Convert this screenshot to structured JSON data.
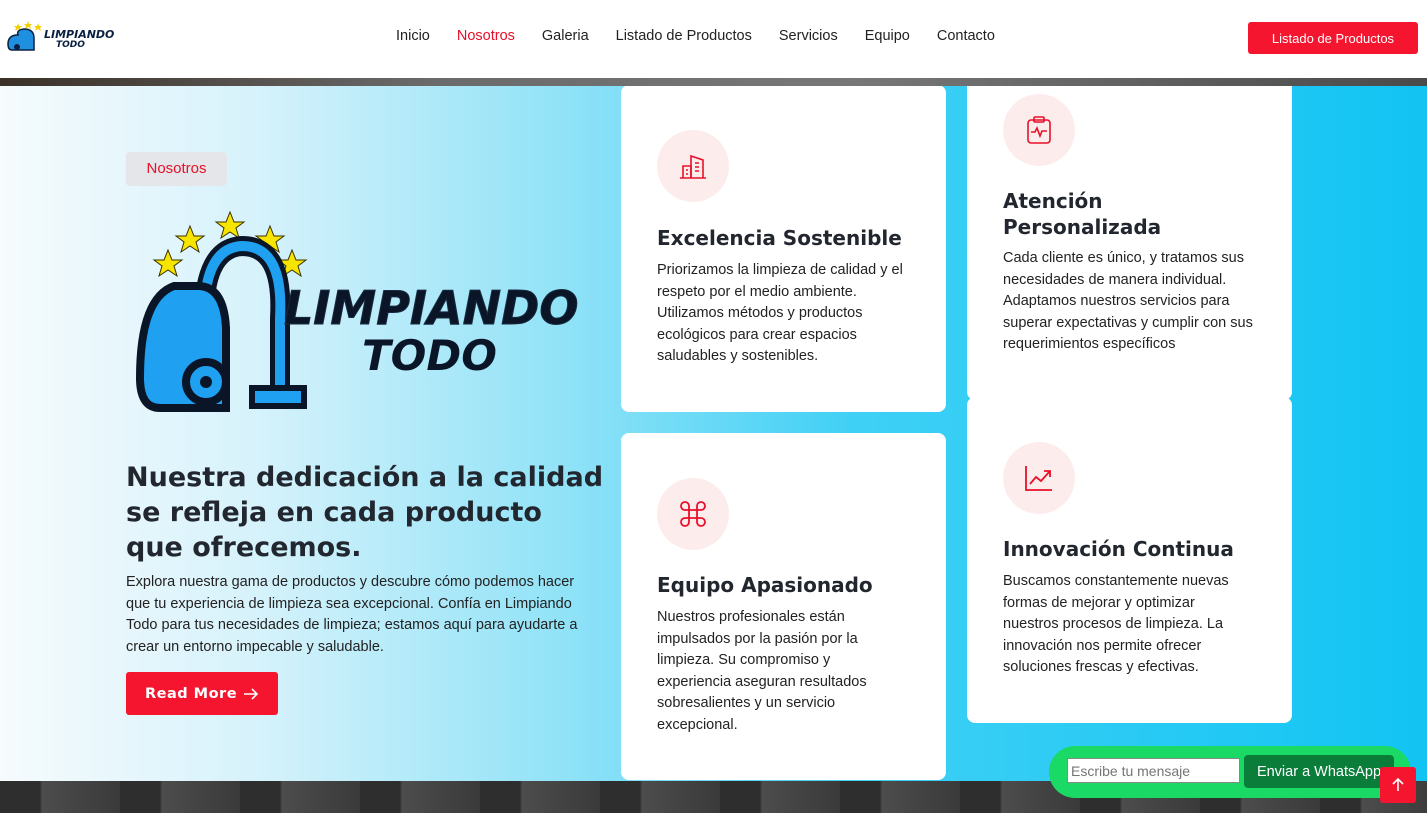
{
  "brand": {
    "name_line1": "LIMPIANDO",
    "name_line2": "TODO"
  },
  "nav": {
    "items": [
      "Inicio",
      "Nosotros",
      "Galeria",
      "Listado de Productos",
      "Servicios",
      "Equipo",
      "Contacto"
    ],
    "active": "Nosotros",
    "cta_label": "Listado de Productos"
  },
  "about": {
    "tag": "Nosotros",
    "heading": "Nuestra dedicación a la calidad se refleja en cada producto que ofrecemos.",
    "paragraph": "Explora nuestra gama de productos y descubre cómo podemos hacer que tu experiencia de limpieza sea excepcional. Confía en Limpiando Todo para tus necesidades de limpieza; estamos aquí para ayudarte a crear un entorno impecable y saludable.",
    "button_label": "Read More"
  },
  "features": [
    {
      "icon": "building-icon",
      "title": "Excelencia Sostenible",
      "text": "Priorizamos la limpieza de calidad y el respeto por el medio ambiente. Utilizamos métodos y productos ecológicos para crear espacios saludables y sostenibles."
    },
    {
      "icon": "clipboard-pulse-icon",
      "title": "Atención Personalizada",
      "text": "Cada cliente es único, y tratamos sus necesidades de manera individual. Adaptamos nuestros servicios para superar expectativas y cumplir con sus requerimientos específicos"
    },
    {
      "icon": "command-icon",
      "title": "Equipo Apasionado",
      "text": "Nuestros profesionales están impulsados por la pasión por la limpieza. Su compromiso y experiencia aseguran resultados sobresalientes y un servicio excepcional."
    },
    {
      "icon": "trend-chart-icon",
      "title": "Innovación Continua",
      "text": "Buscamos constantemente nuevas formas de mejorar y optimizar nuestros procesos de limpieza. La innovación nos permite ofrecer soluciones frescas y efectivas."
    }
  ],
  "whatsapp": {
    "placeholder": "Escribe tu mensaje",
    "button_label": "Enviar a WhatsApp"
  },
  "colors": {
    "accent": "#f5152e",
    "whatsapp": "#1ad964",
    "whatsapp_button": "#0a7d3a",
    "heading": "#22262e"
  }
}
